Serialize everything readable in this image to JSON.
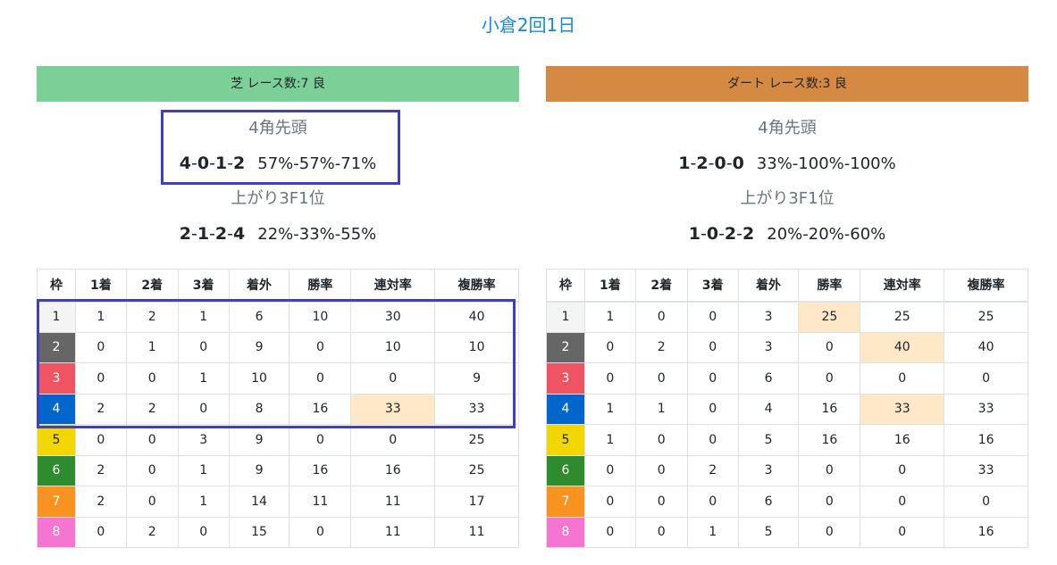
{
  "title": "小倉2回1日",
  "colors": {
    "title": "#1a87d8",
    "turf_header": "#7ccf96",
    "dirt_header": "#d48a43",
    "highlight_cell": "#ffe8c8",
    "annotation_box": "#3f3fbf"
  },
  "waku_colors": [
    "#f4f4f4",
    "#666666",
    "#ef5463",
    "#0066cc",
    "#f2d600",
    "#2e8b2e",
    "#f7931e",
    "#f576d0"
  ],
  "waku_text_colors": [
    "#212529",
    "#ffffff",
    "#ffffff",
    "#ffffff",
    "#212529",
    "#ffffff",
    "#ffffff",
    "#ffffff"
  ],
  "table_headers": [
    "枠",
    "1着",
    "2着",
    "3着",
    "着外",
    "勝率",
    "連対率",
    "複勝率"
  ],
  "panels": [
    {
      "header": "芝 レース数:7  良",
      "header_color": "#7ccf96",
      "corner_label": "4角先頭",
      "corner_counts": [
        "4",
        "0",
        "1",
        "2"
      ],
      "corner_rates": "57%-57%-71%",
      "agari_label": "上がり3F1位",
      "agari_counts": [
        "2",
        "1",
        "2",
        "4"
      ],
      "agari_rates": "22%-33%-55%",
      "rows": [
        [
          "1",
          "1",
          "2",
          "1",
          "6",
          "10",
          "30",
          "40"
        ],
        [
          "2",
          "0",
          "1",
          "0",
          "9",
          "0",
          "10",
          "10"
        ],
        [
          "3",
          "0",
          "0",
          "1",
          "10",
          "0",
          "0",
          "9"
        ],
        [
          "4",
          "2",
          "2",
          "0",
          "8",
          "16",
          "33",
          "33"
        ],
        [
          "5",
          "0",
          "0",
          "3",
          "9",
          "0",
          "0",
          "25"
        ],
        [
          "6",
          "2",
          "0",
          "1",
          "9",
          "16",
          "16",
          "25"
        ],
        [
          "7",
          "2",
          "0",
          "1",
          "14",
          "11",
          "11",
          "17"
        ],
        [
          "8",
          "0",
          "2",
          "0",
          "15",
          "0",
          "11",
          "11"
        ]
      ],
      "highlights": [
        [
          3,
          6
        ]
      ]
    },
    {
      "header": "ダート レース数:3  良",
      "header_color": "#d48a43",
      "corner_label": "4角先頭",
      "corner_counts": [
        "1",
        "2",
        "0",
        "0"
      ],
      "corner_rates": "33%-100%-100%",
      "agari_label": "上がり3F1位",
      "agari_counts": [
        "1",
        "0",
        "2",
        "2"
      ],
      "agari_rates": "20%-20%-60%",
      "rows": [
        [
          "1",
          "1",
          "0",
          "0",
          "3",
          "25",
          "25",
          "25"
        ],
        [
          "2",
          "0",
          "2",
          "0",
          "3",
          "0",
          "40",
          "40"
        ],
        [
          "3",
          "0",
          "0",
          "0",
          "6",
          "0",
          "0",
          "0"
        ],
        [
          "4",
          "1",
          "1",
          "0",
          "4",
          "16",
          "33",
          "33"
        ],
        [
          "5",
          "1",
          "0",
          "0",
          "5",
          "16",
          "16",
          "16"
        ],
        [
          "6",
          "0",
          "0",
          "2",
          "3",
          "0",
          "0",
          "33"
        ],
        [
          "7",
          "0",
          "0",
          "0",
          "6",
          "0",
          "0",
          "0"
        ],
        [
          "8",
          "0",
          "0",
          "1",
          "5",
          "0",
          "0",
          "16"
        ]
      ],
      "highlights": [
        [
          0,
          5
        ],
        [
          1,
          6
        ],
        [
          3,
          6
        ]
      ]
    }
  ]
}
